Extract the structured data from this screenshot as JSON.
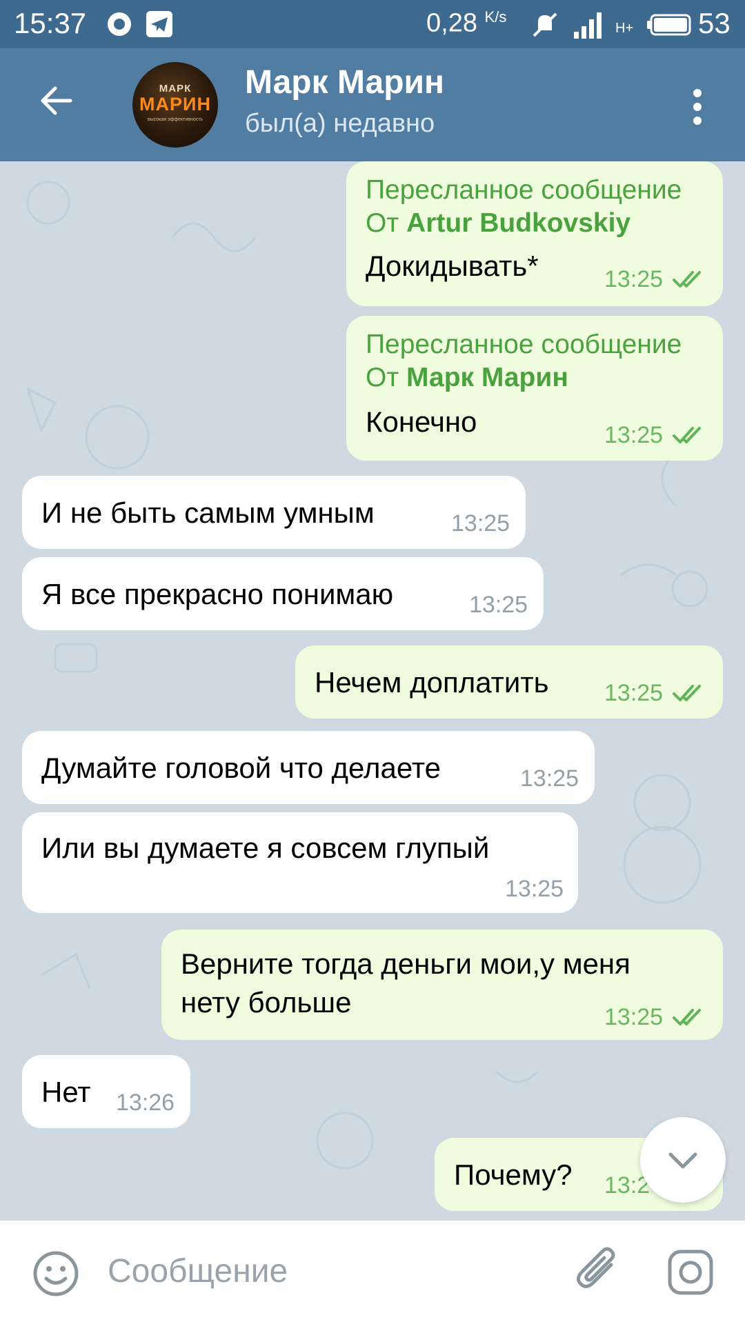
{
  "status_bar": {
    "time": "15:37",
    "speed": "0,28",
    "speed_unit": "K/s",
    "network": "H+",
    "battery": "53"
  },
  "header": {
    "contact_name": "Марк Марин",
    "contact_status": "был(а) недавно",
    "avatar_text": {
      "line1": "МАРК",
      "line2": "МАРИН",
      "line3": "высокая эффективность"
    }
  },
  "messages": [
    {
      "dir": "out",
      "forward_label": "Пересланное сообщение",
      "forward_from_prefix": "От",
      "forward_from": "Artur Budkovskiy",
      "text": "Докидывать*",
      "time": "13:25",
      "read": true
    },
    {
      "dir": "out",
      "forward_label": "Пересланное сообщение",
      "forward_from_prefix": "От",
      "forward_from": "Марк Марин",
      "text": "Конечно",
      "time": "13:25",
      "read": true
    },
    {
      "dir": "in",
      "text": "И не быть самым умным",
      "time": "13:25"
    },
    {
      "dir": "in",
      "text": "Я все прекрасно понимаю",
      "time": "13:25"
    },
    {
      "dir": "out",
      "text": "Нечем доплатить",
      "time": "13:25",
      "read": true
    },
    {
      "dir": "in",
      "text": "Думайте головой что делаете",
      "time": "13:25"
    },
    {
      "dir": "in",
      "text": "Или вы думаете я совсем глупый",
      "time": "13:25"
    },
    {
      "dir": "out",
      "text_line1": "Верните тогда деньги мои,у меня",
      "text_line2": "нету больше",
      "time": "13:25",
      "read": true
    },
    {
      "dir": "in",
      "text": "Нет",
      "time": "13:26"
    },
    {
      "dir": "out",
      "text": "Почему?",
      "time": "13:2"
    }
  ],
  "input": {
    "placeholder": "Сообщение"
  },
  "colors": {
    "header_bg": "#527da3",
    "statusbar_bg": "#3f6a90",
    "chat_bg": "#cfd9e1",
    "incoming_bubble": "#ffffff",
    "outgoing_bubble": "#effdde",
    "accent_green": "#4aa23f"
  },
  "icons": [
    "back-arrow-icon",
    "more-vert-icon",
    "double-check-icon",
    "chevron-down-icon",
    "emoji-icon",
    "attach-icon",
    "camera-icon"
  ]
}
